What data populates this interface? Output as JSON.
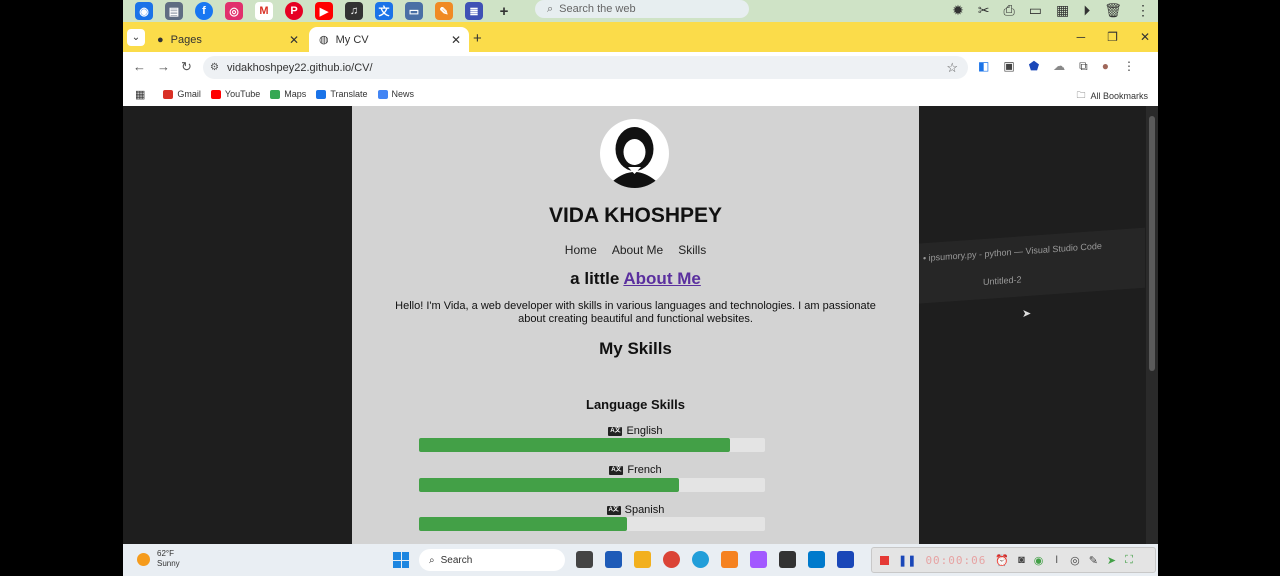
{
  "launcher": {
    "search_placeholder": "Search the web",
    "apps": [
      "chrome-alt-icon",
      "files-icon",
      "facebook-icon",
      "instagram-icon",
      "gmail-icon",
      "pinterest-icon",
      "youtube-icon",
      "music-icon",
      "translate-icon",
      "tv-icon",
      "carrot-icon",
      "doc-icon"
    ]
  },
  "browser": {
    "tabs": [
      {
        "label": "Pages",
        "icon": "github-icon"
      },
      {
        "label": "My CV",
        "icon": "globe-icon"
      }
    ],
    "url": "vidakhoshpey22.github.io/CV/",
    "bookmarks": [
      "Gmail",
      "YouTube",
      "Maps",
      "Translate",
      "News"
    ],
    "all_bookmarks": "All Bookmarks"
  },
  "cv": {
    "name": "VIDA KHOSHPEY",
    "nav": [
      "Home",
      "About Me",
      "Skills"
    ],
    "about_prefix": "a little ",
    "about_link": "About Me",
    "about_text": "Hello! I'm Vida, a web developer with skills in various languages and technologies. I am passionate about creating beautiful and functional websites.",
    "skills_title": "My Skills",
    "language_title": "Language Skills",
    "languages": [
      {
        "name": "English",
        "level": 0.9
      },
      {
        "name": "French",
        "level": 0.75
      },
      {
        "name": "Spanish",
        "level": 0.6
      }
    ]
  },
  "background_app": {
    "title": "• ipsumory.py - python — Visual Studio Code",
    "tab": "Untitled-2"
  },
  "taskbar": {
    "temp": "62°F",
    "condition": "Sunny",
    "search": "Search",
    "recorder_time": "00:00:06"
  }
}
